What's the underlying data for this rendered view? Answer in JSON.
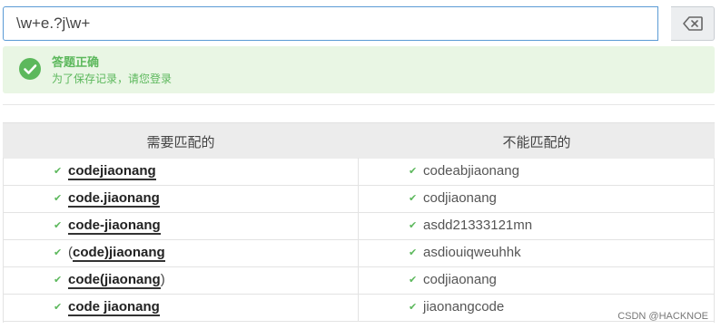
{
  "regex": {
    "value": "\\w+e.?j\\w+"
  },
  "clear_button": {
    "icon": "backspace-icon"
  },
  "result": {
    "icon": "check-circle-icon",
    "title": "答题正确",
    "subtitle": "为了保存记录，请您登录"
  },
  "table": {
    "headers": {
      "match": "需要匹配的",
      "nomatch": "不能匹配的"
    },
    "rows": [
      {
        "left": [
          {
            "t": "codejiaonang",
            "m": true
          }
        ],
        "right": "codeabjiaonang"
      },
      {
        "left": [
          {
            "t": "code.jiaonang",
            "m": true
          }
        ],
        "right": "codjiaonang"
      },
      {
        "left": [
          {
            "t": "code-jiaonang",
            "m": true
          }
        ],
        "right": "asdd21333121mn"
      },
      {
        "left": [
          {
            "t": "(",
            "m": false
          },
          {
            "t": "code)jiaonang",
            "m": true
          }
        ],
        "right": "asdiouiqweuhhk"
      },
      {
        "left": [
          {
            "t": "code(jiaonang",
            "m": true
          },
          {
            "t": ")",
            "m": false
          }
        ],
        "right": "codjiaonang"
      },
      {
        "left": [
          {
            "t": "code jiaonang",
            "m": true
          }
        ],
        "right": "jiaonangcode"
      }
    ]
  },
  "watermark": "CSDN @HACKNOE",
  "colors": {
    "success": "#5cb85c",
    "success_bg": "#e9f6e4",
    "input_border": "#5b9bd5"
  }
}
